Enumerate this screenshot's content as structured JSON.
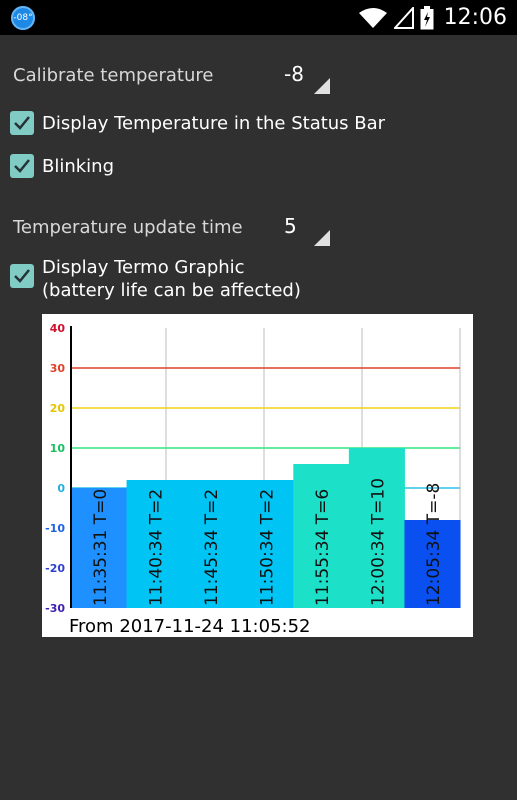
{
  "status_bar": {
    "temp_badge": "-08°",
    "icons": [
      "wifi-icon",
      "signal-icon",
      "battery-icon"
    ],
    "time": "12:06"
  },
  "settings": {
    "calibrate": {
      "label": "Calibrate temperature",
      "value": "-8"
    },
    "display_status_bar": {
      "label": "Display Temperature in the Status Bar",
      "checked": true
    },
    "blinking": {
      "label": "Blinking",
      "checked": true
    },
    "update_time": {
      "label": "Temperature update time",
      "value": "5"
    },
    "termo_graphic": {
      "label_line1": "Display Termo Graphic",
      "label_line2": "(battery life can be affected)",
      "checked": true
    }
  },
  "colors": {
    "background": "#303030",
    "check_fill": "#80cbc4",
    "line_30": "#e0412a",
    "line_20": "#f1d21a",
    "line_10": "#2ee87b",
    "line_0": "#2ec4e8"
  },
  "chart_data": {
    "type": "bar",
    "ylim": [
      -30,
      40
    ],
    "yticks": [
      40,
      30,
      20,
      10,
      0,
      -10,
      -20,
      -30
    ],
    "grid": true,
    "reference_lines": [
      30,
      20,
      10,
      0
    ],
    "bars": [
      {
        "label": "11:35:31 T=0",
        "value": 0,
        "color": "#1e90ff"
      },
      {
        "label": "11:40:34 T=2",
        "value": 2,
        "color": "#00c4f4"
      },
      {
        "label": "11:45:34 T=2",
        "value": 2,
        "color": "#00c4f4"
      },
      {
        "label": "11:50:34 T=2",
        "value": 2,
        "color": "#00c4f4"
      },
      {
        "label": "11:55:34 T=6",
        "value": 6,
        "color": "#1de0c8"
      },
      {
        "label": "12:00:34 T=10",
        "value": 10,
        "color": "#1de0c8"
      },
      {
        "label": "12:05:34 T=-8",
        "value": -8,
        "color": "#0a50f0"
      }
    ],
    "footer": "From 2017-11-24 11:05:52"
  }
}
